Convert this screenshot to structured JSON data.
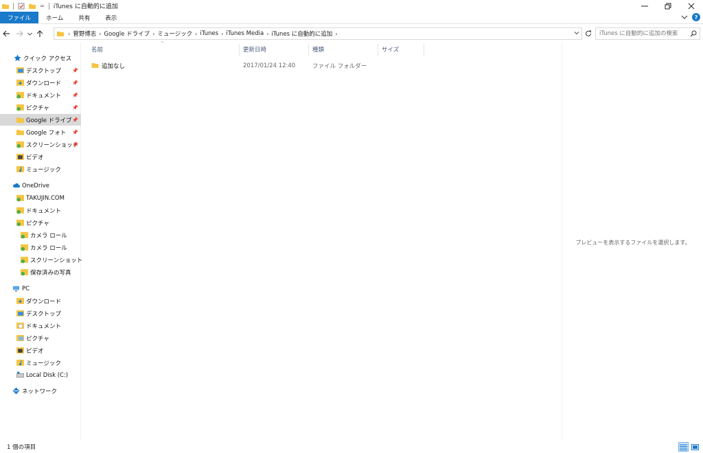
{
  "window": {
    "title": "iTunes に自動的に追加",
    "qa_dropdown": "="
  },
  "ribbon": {
    "tabs": [
      "ファイル",
      "ホーム",
      "共有",
      "表示"
    ]
  },
  "address": {
    "crumbs": [
      "菅野博志",
      "Google ドライブ",
      "ミュージック",
      "iTunes",
      "iTunes Media",
      "iTunes に自動的に追加"
    ],
    "separator": "›"
  },
  "search": {
    "placeholder": "iTunes に自動的に追加の検索"
  },
  "nav": {
    "quick_access": "クイック アクセス",
    "quick_items": [
      "デスクトップ",
      "ダウンロード",
      "ドキュメント",
      "ピクチャ",
      "Google ドライブ",
      "Google フォト",
      "スクリーンショット",
      "ビデオ",
      "ミュージック"
    ],
    "onedrive": "OneDrive",
    "onedrive_items": [
      "TAKUJIN.COM",
      "ドキュメント",
      "ピクチャ"
    ],
    "onedrive_sub": [
      "カメラ ロール",
      "カメラ ロール",
      "スクリーンショット",
      "保存済みの写真"
    ],
    "pc": "PC",
    "pc_items": [
      "ダウンロード",
      "デスクトップ",
      "ドキュメント",
      "ピクチャ",
      "ビデオ",
      "ミュージック",
      "Local Disk (C:)"
    ],
    "network": "ネットワーク"
  },
  "columns": {
    "name": "名前",
    "date": "更新日時",
    "type": "種類",
    "size": "サイズ"
  },
  "files": [
    {
      "name": "追加なし",
      "date": "2017/01/24 12:40",
      "type": "ファイル フォルダー",
      "size": ""
    }
  ],
  "preview": {
    "message": "プレビューを表示するファイルを選択します。"
  },
  "status": {
    "count": "1 個の項目"
  },
  "colors": {
    "accent": "#1979ca",
    "folder": "#f5c542",
    "selection": "#d9d9d9"
  }
}
